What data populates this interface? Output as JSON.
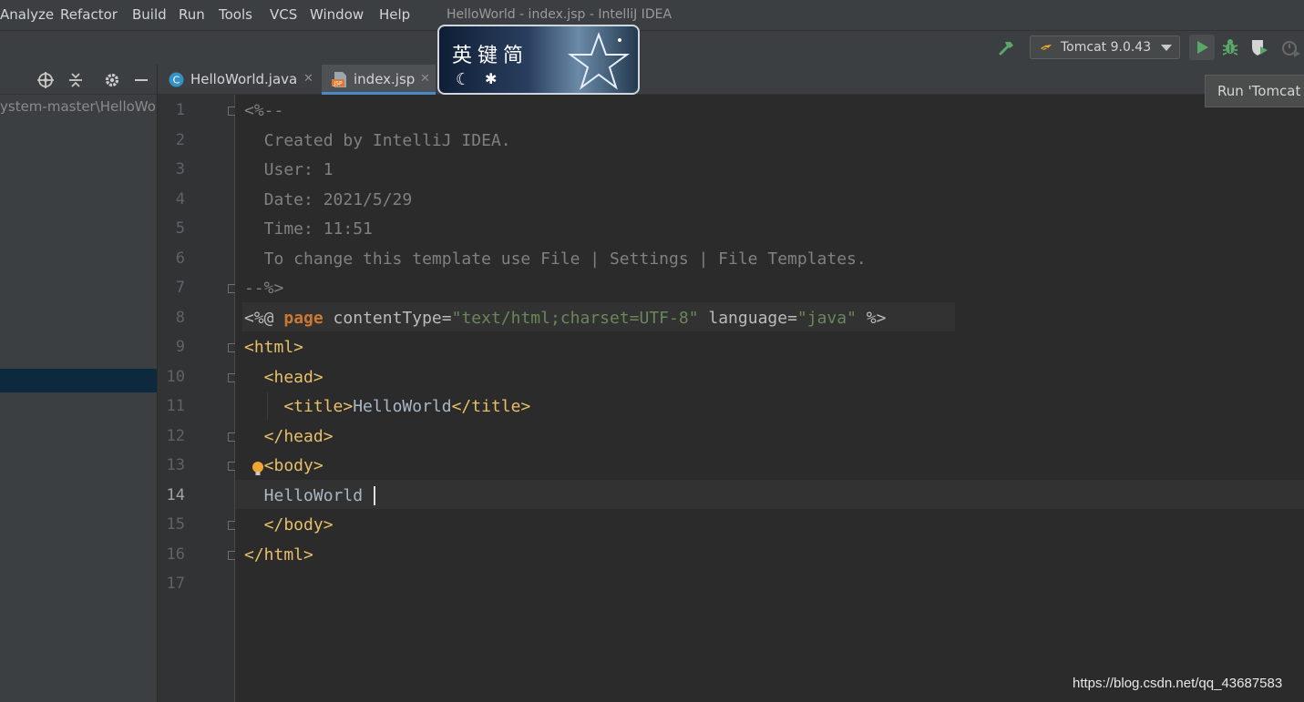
{
  "menu": {
    "items": [
      {
        "label": "Analyze"
      },
      {
        "label": "Refactor"
      },
      {
        "label": "Build"
      },
      {
        "label": "Run"
      },
      {
        "label": "Tools"
      },
      {
        "label": "VCS"
      },
      {
        "label": "Window"
      },
      {
        "label": "Help"
      }
    ]
  },
  "window_title": "HelloWorld - index.jsp - IntelliJ IDEA",
  "toolbar": {
    "run_config_label": "Tomcat 9.0.43",
    "run_config_icon": "tomcat-icon",
    "build_icon": "hammer-icon",
    "run_icon": "run-icon",
    "debug_icon": "debug-icon",
    "coverage_icon": "coverage-icon",
    "profile_icon": "profile-icon"
  },
  "tooltip": {
    "text": "Run 'Tomcat"
  },
  "project_panel": {
    "path_text": "ystem-master\\HelloWor",
    "header_icons": [
      "locate-icon",
      "collapse-icon",
      "gear-icon",
      "minimize-icon"
    ]
  },
  "tabs": [
    {
      "label": "HelloWorld.java",
      "icon": "java-class-icon",
      "active": false,
      "close": "✕"
    },
    {
      "label": "index.jsp",
      "icon": "jsp-file-icon",
      "active": true,
      "close": "✕"
    }
  ],
  "ime_widget": {
    "chars": "英键简",
    "icons": [
      "moon-icon",
      "gear-icon",
      "star-icon"
    ]
  },
  "editor": {
    "current_line": 14,
    "lines": [
      {
        "n": "1",
        "segments": [
          {
            "c": "comment",
            "t": "<%--"
          }
        ]
      },
      {
        "n": "2",
        "segments": [
          {
            "c": "comment",
            "t": "  Created by IntelliJ IDEA."
          }
        ]
      },
      {
        "n": "3",
        "segments": [
          {
            "c": "comment",
            "t": "  User: 1"
          }
        ]
      },
      {
        "n": "4",
        "segments": [
          {
            "c": "comment",
            "t": "  Date: 2021/5/29"
          }
        ]
      },
      {
        "n": "5",
        "segments": [
          {
            "c": "comment",
            "t": "  Time: 11:51"
          }
        ]
      },
      {
        "n": "6",
        "segments": [
          {
            "c": "comment",
            "t": "  To change this template use File | Settings | File Templates."
          }
        ]
      },
      {
        "n": "7",
        "segments": [
          {
            "c": "comment",
            "t": "--%>"
          }
        ]
      },
      {
        "n": "8",
        "segments": [
          {
            "c": "plain",
            "t": "<%@ "
          },
          {
            "c": "kw",
            "t": "page"
          },
          {
            "c": "plain",
            "t": " contentType="
          },
          {
            "c": "str",
            "t": "\"text/html;charset=UTF-8\""
          },
          {
            "c": "plain",
            "t": " language="
          },
          {
            "c": "str",
            "t": "\"java\""
          },
          {
            "c": "plain",
            "t": " %>"
          }
        ]
      },
      {
        "n": "9",
        "segments": [
          {
            "c": "tag",
            "t": "<html>"
          }
        ]
      },
      {
        "n": "10",
        "segments": [
          {
            "c": "tag",
            "t": "  <head>"
          }
        ]
      },
      {
        "n": "11",
        "segments": [
          {
            "c": "tag",
            "t": "    <title>"
          },
          {
            "c": "text",
            "t": "HelloWorld"
          },
          {
            "c": "tag",
            "t": "</title>"
          }
        ]
      },
      {
        "n": "12",
        "segments": [
          {
            "c": "tag",
            "t": "  </head>"
          }
        ]
      },
      {
        "n": "13",
        "segments": [
          {
            "c": "tag",
            "t": "  <body>"
          }
        ]
      },
      {
        "n": "14",
        "segments": [
          {
            "c": "text",
            "t": "  HelloWorld"
          }
        ]
      },
      {
        "n": "15",
        "segments": [
          {
            "c": "tag",
            "t": "  </body>"
          }
        ]
      },
      {
        "n": "16",
        "segments": [
          {
            "c": "tag",
            "t": "</html>"
          }
        ]
      },
      {
        "n": "17",
        "segments": []
      }
    ],
    "fold_markers": [
      1,
      7,
      9,
      10,
      12,
      13,
      15,
      16
    ]
  },
  "watermark": "https://blog.csdn.net/qq_43687583"
}
